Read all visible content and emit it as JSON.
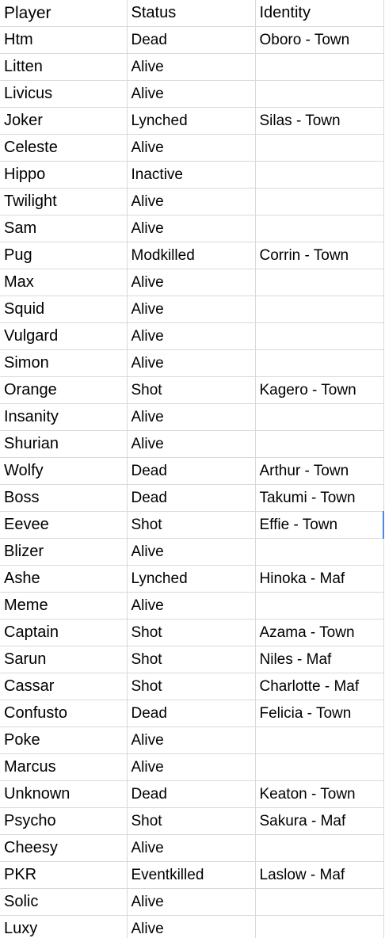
{
  "headers": {
    "player": "Player",
    "status": "Status",
    "identity": "Identity"
  },
  "rows": [
    {
      "player": "Htm",
      "status": "Dead",
      "identity": "Oboro - Town"
    },
    {
      "player": "Litten",
      "status": "Alive",
      "identity": ""
    },
    {
      "player": "Livicus",
      "status": "Alive",
      "identity": ""
    },
    {
      "player": "Joker",
      "status": "Lynched",
      "identity": "Silas - Town"
    },
    {
      "player": "Celeste",
      "status": "Alive",
      "identity": ""
    },
    {
      "player": "Hippo",
      "status": "Inactive",
      "identity": ""
    },
    {
      "player": "Twilight",
      "status": "Alive",
      "identity": ""
    },
    {
      "player": "Sam",
      "status": "Alive",
      "identity": ""
    },
    {
      "player": "Pug",
      "status": "Modkilled",
      "identity": "Corrin - Town"
    },
    {
      "player": "Max",
      "status": "Alive",
      "identity": ""
    },
    {
      "player": "Squid",
      "status": "Alive",
      "identity": ""
    },
    {
      "player": "Vulgard",
      "status": "Alive",
      "identity": ""
    },
    {
      "player": "Simon",
      "status": "Alive",
      "identity": ""
    },
    {
      "player": "Orange",
      "status": "Shot",
      "identity": "Kagero - Town"
    },
    {
      "player": "Insanity",
      "status": "Alive",
      "identity": ""
    },
    {
      "player": "Shurian",
      "status": "Alive",
      "identity": ""
    },
    {
      "player": "Wolfy",
      "status": "Dead",
      "identity": "Arthur - Town"
    },
    {
      "player": "Boss",
      "status": "Dead",
      "identity": "Takumi - Town"
    },
    {
      "player": "Eevee",
      "status": "Shot",
      "identity": "Effie - Town"
    },
    {
      "player": "Blizer",
      "status": "Alive",
      "identity": ""
    },
    {
      "player": "Ashe",
      "status": "Lynched",
      "identity": "Hinoka - Maf"
    },
    {
      "player": "Meme",
      "status": "Alive",
      "identity": ""
    },
    {
      "player": "Captain",
      "status": "Shot",
      "identity": "Azama - Town"
    },
    {
      "player": "Sarun",
      "status": "Shot",
      "identity": "Niles - Maf"
    },
    {
      "player": "Cassar",
      "status": "Shot",
      "identity": "Charlotte - Maf"
    },
    {
      "player": "Confusto",
      "status": "Dead",
      "identity": "Felicia - Town"
    },
    {
      "player": "Poke",
      "status": "Alive",
      "identity": ""
    },
    {
      "player": "Marcus",
      "status": "Alive",
      "identity": ""
    },
    {
      "player": "Unknown",
      "status": "Dead",
      "identity": "Keaton - Town"
    },
    {
      "player": "Psycho",
      "status": "Shot",
      "identity": "Sakura - Maf"
    },
    {
      "player": "Cheesy",
      "status": "Alive",
      "identity": ""
    },
    {
      "player": "PKR",
      "status": "Eventkilled",
      "identity": "Laslow - Maf"
    },
    {
      "player": "Solic",
      "status": "Alive",
      "identity": ""
    },
    {
      "player": "Luxy",
      "status": "Alive",
      "identity": ""
    }
  ],
  "colors": {
    "grid_line": "#d9d9d9",
    "selection": "#4a86e8",
    "text": "#000000",
    "background": "#ffffff"
  }
}
